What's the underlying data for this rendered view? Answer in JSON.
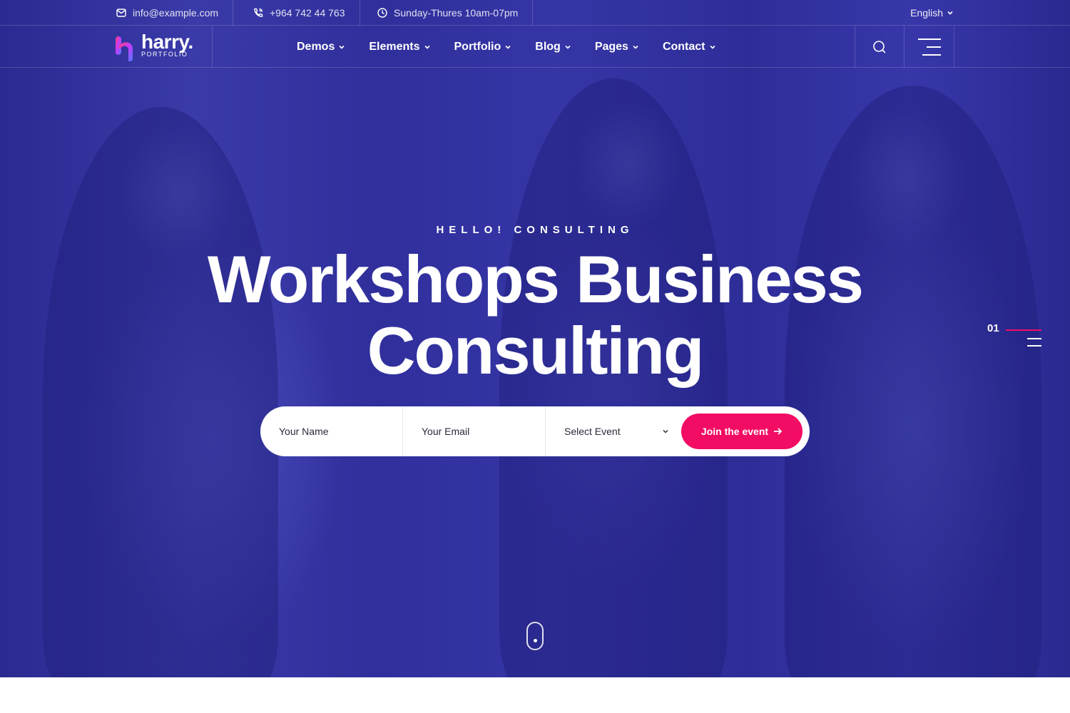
{
  "topbar": {
    "email": "info@example.com",
    "phone": "+964 742 44 763",
    "hours": "Sunday-Thures 10am-07pm",
    "language": "English"
  },
  "nav": {
    "logo_name": "harry.",
    "logo_sub": "PORTFOLIO",
    "items": [
      {
        "label": "Demos"
      },
      {
        "label": "Elements"
      },
      {
        "label": "Portfolio"
      },
      {
        "label": "Blog"
      },
      {
        "label": "Pages"
      },
      {
        "label": "Contact"
      }
    ]
  },
  "hero": {
    "eyebrow": "HELLO! CONSULTING",
    "title_line1": "Workshops Business",
    "title_line2": "Consulting"
  },
  "form": {
    "name_placeholder": "Your Name",
    "email_placeholder": "Your Email",
    "select_value": "Select Event",
    "submit_label": "Join the event"
  },
  "slider": {
    "current": "01"
  },
  "colors": {
    "accent": "#f20c63",
    "hero_overlay": "#2f2e9e"
  },
  "icons": [
    "mail-icon",
    "phone-icon",
    "clock-icon",
    "chevron-down-icon",
    "search-icon",
    "menu-icon",
    "arrow-right-icon",
    "scroll-mouse-icon"
  ]
}
